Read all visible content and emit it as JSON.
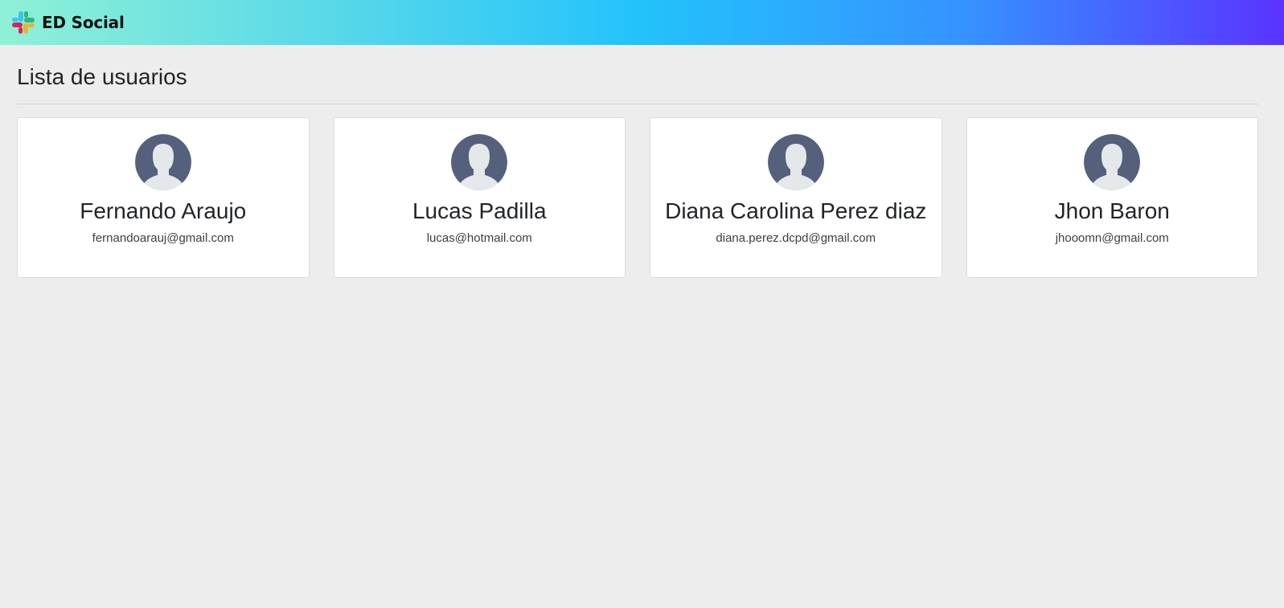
{
  "navbar": {
    "brand_name": "ED Social",
    "logo_icon": "slack-style-hash-logo-icon",
    "gradient_colors": [
      "#8ff1d6",
      "#23c2fb",
      "#5a33ff"
    ]
  },
  "main": {
    "title": "Lista de usuarios",
    "users": [
      {
        "name": "Fernando Araujo",
        "email": "fernandoarauj@gmail.com",
        "avatar_icon": "user-avatar-icon"
      },
      {
        "name": "Lucas Padilla",
        "email": "lucas@hotmail.com",
        "avatar_icon": "user-avatar-icon"
      },
      {
        "name": "Diana Carolina Perez diaz",
        "email": "diana.perez.dcpd@gmail.com",
        "avatar_icon": "user-avatar-icon"
      },
      {
        "name": "Jhon Baron",
        "email": "jhooomn@gmail.com",
        "avatar_icon": "user-avatar-icon"
      }
    ]
  },
  "colors": {
    "background": "#ededed",
    "card": "#ffffff",
    "avatar_bg": "#55607d",
    "avatar_silhouette": "#e4e8ea"
  }
}
